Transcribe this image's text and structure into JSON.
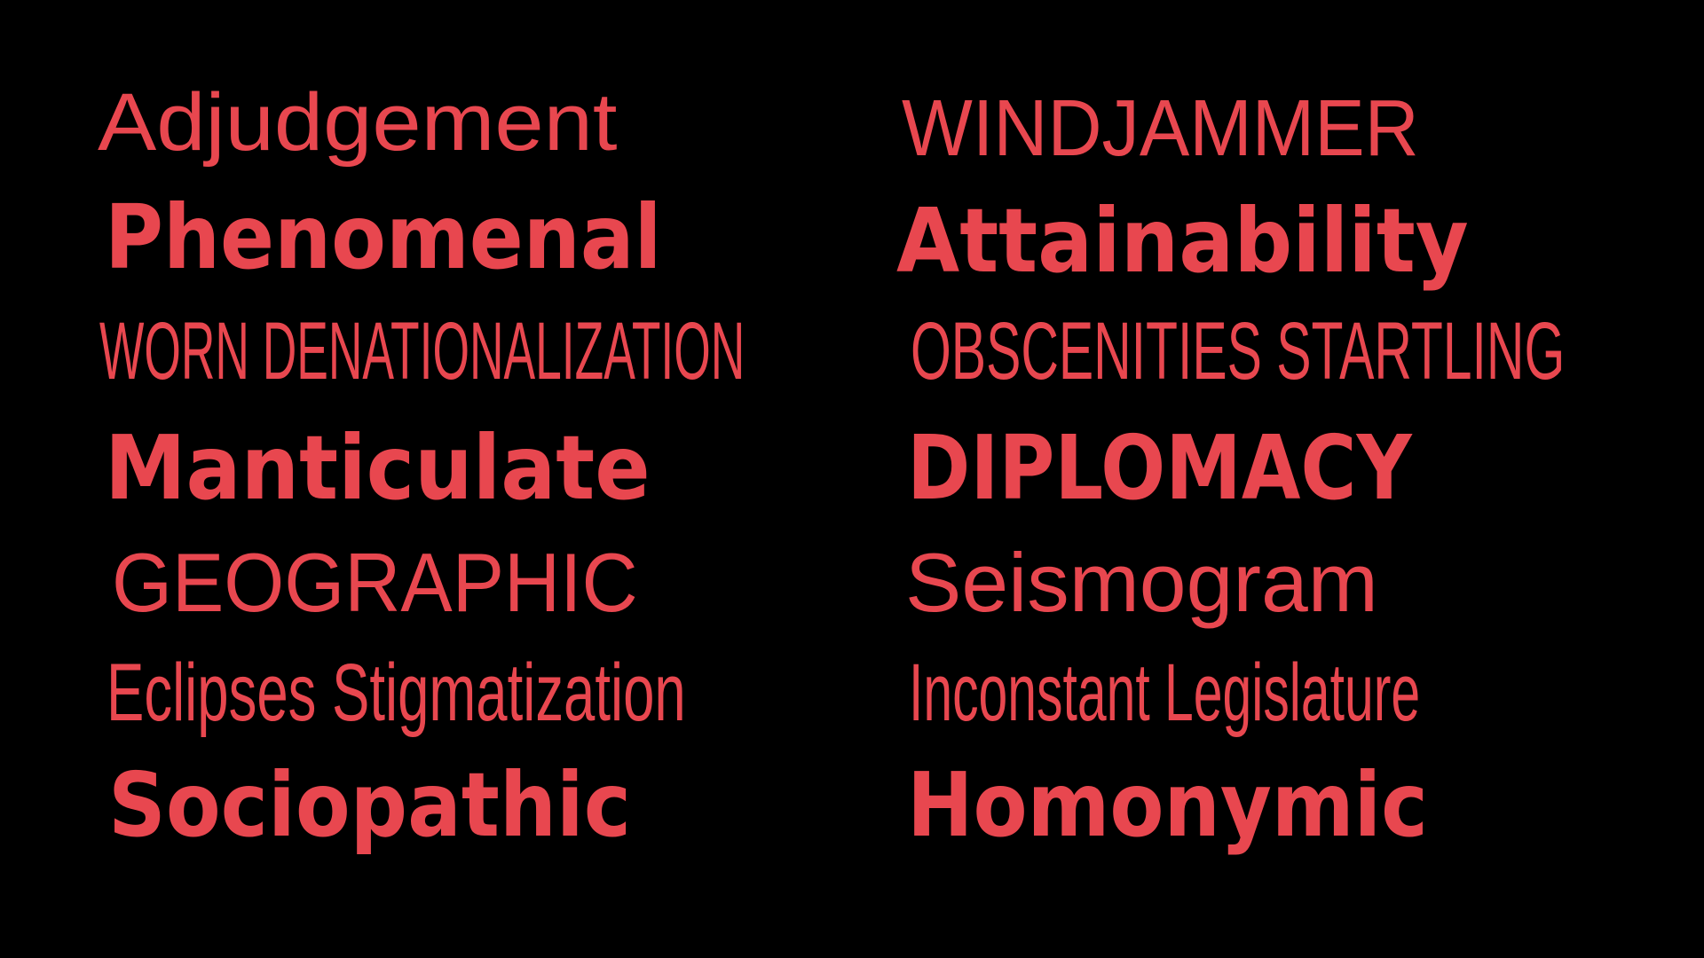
{
  "colors": {
    "background": "#000000",
    "text": "#e8474f"
  },
  "words": {
    "left": [
      "Adjudgement",
      "Phenomenal",
      "WORN DENATIONALIZATION",
      "Manticulate",
      "GEOGRAPHIC",
      "Eclipses Stigmatization",
      "Sociopathic"
    ],
    "right": [
      "WINDJAMMER",
      "Attainability",
      "OBSCENITIES STARTLING",
      "DIPLOMACY",
      "Seismogram",
      "Inconstant Legislature",
      "Homonymic"
    ]
  }
}
